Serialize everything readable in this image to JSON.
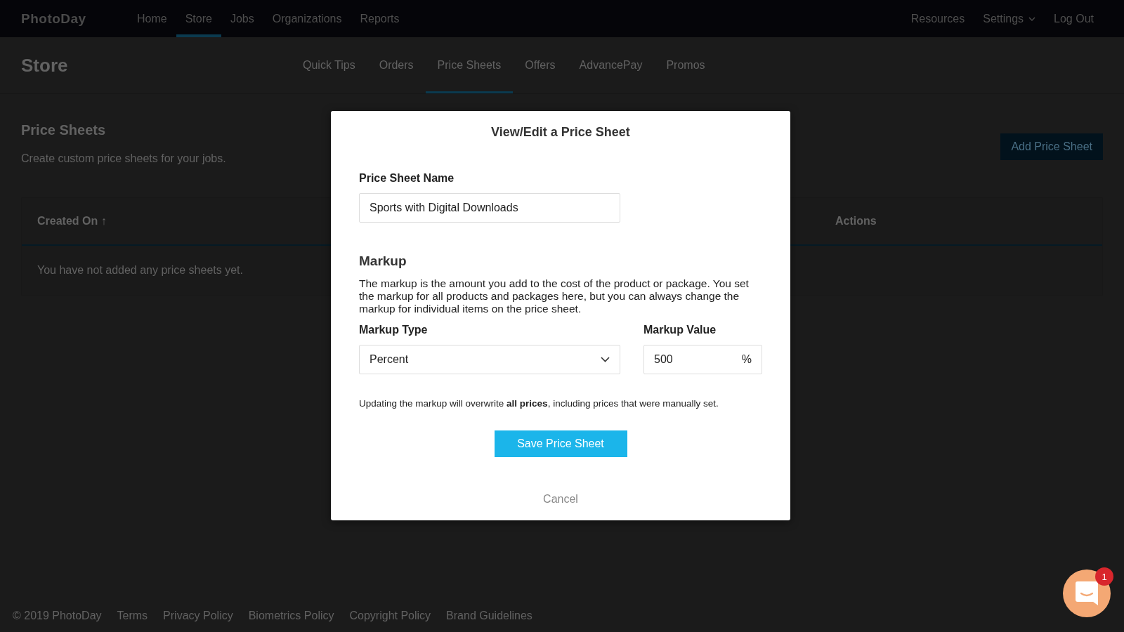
{
  "header": {
    "logo": "PhotoDay",
    "nav": [
      {
        "label": "Home",
        "selected": false
      },
      {
        "label": "Store",
        "selected": true
      },
      {
        "label": "Jobs",
        "selected": false
      },
      {
        "label": "Organizations",
        "selected": false
      },
      {
        "label": "Reports",
        "selected": false
      }
    ],
    "right_nav": [
      {
        "label": "Resources",
        "kind": "link"
      },
      {
        "label": "Settings",
        "kind": "dropdown"
      },
      {
        "label": "Log Out",
        "kind": "link"
      }
    ]
  },
  "subheader": {
    "title": "Store",
    "tabs": [
      {
        "label": "Quick Tips",
        "selected": false
      },
      {
        "label": "Orders",
        "selected": false
      },
      {
        "label": "Price Sheets",
        "selected": true
      },
      {
        "label": "Offers",
        "selected": false
      },
      {
        "label": "AdvancePay",
        "selected": false
      },
      {
        "label": "Promos",
        "selected": false
      }
    ]
  },
  "page": {
    "title": "Price Sheets",
    "subtitle": "Create custom price sheets for your jobs.",
    "add_button": "Add Price Sheet",
    "table": {
      "columns": [
        "Created On ↑",
        "Actions"
      ],
      "empty_message": "You have not added any price sheets yet."
    }
  },
  "footer": [
    "© 2019 PhotoDay",
    "Terms",
    "Privacy Policy",
    "Biometrics Policy",
    "Copyright Policy",
    "Brand Guidelines"
  ],
  "modal": {
    "title": "View/Edit a Price Sheet",
    "name_label": "Price Sheet Name",
    "name_value": "Sports with Digital Downloads",
    "markup_heading": "Markup",
    "markup_description": "The markup is the amount you add to the cost of the product or package. You set the markup for all products and packages here, but you can always change the markup for individual items on the price sheet.",
    "markup_type_label": "Markup Type",
    "markup_type_value": "Percent",
    "markup_value_label": "Markup Value",
    "markup_value": "500",
    "markup_unit": "%",
    "warning": "Updating the markup will overwrite **all prices**, including prices that were manually set.",
    "save_button": "Save Price Sheet",
    "cancel_button": "Cancel"
  },
  "chat": {
    "badge": "1"
  }
}
